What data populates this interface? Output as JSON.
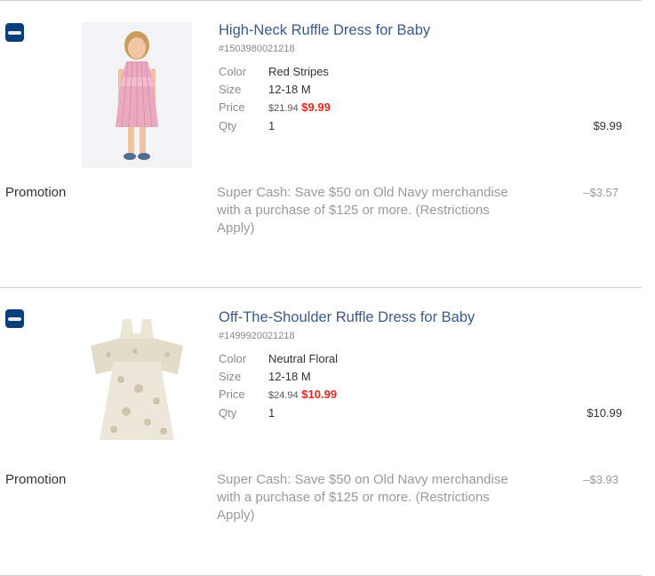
{
  "items": [
    {
      "brand_icon": "old-navy-logo-icon",
      "image_icon": "pink-striped-dress-photo",
      "name": "High-Neck Ruffle Dress for Baby",
      "sku": "#1503980021218",
      "color_label": "Color",
      "color_value": "Red Stripes",
      "size_label": "Size",
      "size_value": "12-18 M",
      "price_label": "Price",
      "price_was": "$21.94",
      "price_now": "$9.99",
      "qty_label": "Qty",
      "qty_value": "1",
      "line_total": "$9.99",
      "promo_label": "Promotion",
      "promo_text": "Super Cash: Save $50 on Old Navy merchandise with a purchase of $125 or more. (Restrictions Apply)",
      "promo_amount": "–$3.57"
    },
    {
      "brand_icon": "old-navy-logo-icon",
      "image_icon": "floral-dress-photo",
      "name": "Off-The-Shoulder Ruffle Dress for Baby",
      "sku": "#1499920021218",
      "color_label": "Color",
      "color_value": "Neutral Floral",
      "size_label": "Size",
      "size_value": "12-18 M",
      "price_label": "Price",
      "price_was": "$24.94",
      "price_now": "$10.99",
      "qty_label": "Qty",
      "qty_value": "1",
      "line_total": "$10.99",
      "promo_label": "Promotion",
      "promo_text": "Super Cash: Save $50 on Old Navy merchandise with a purchase of $125 or more. (Restrictions Apply)",
      "promo_amount": "–$3.93"
    }
  ],
  "colors": {
    "product_link": "#3a5a88",
    "sale_price": "#e8261e",
    "brand_badge": "#0b3f7a",
    "promo_text": "#9a9a9a"
  }
}
